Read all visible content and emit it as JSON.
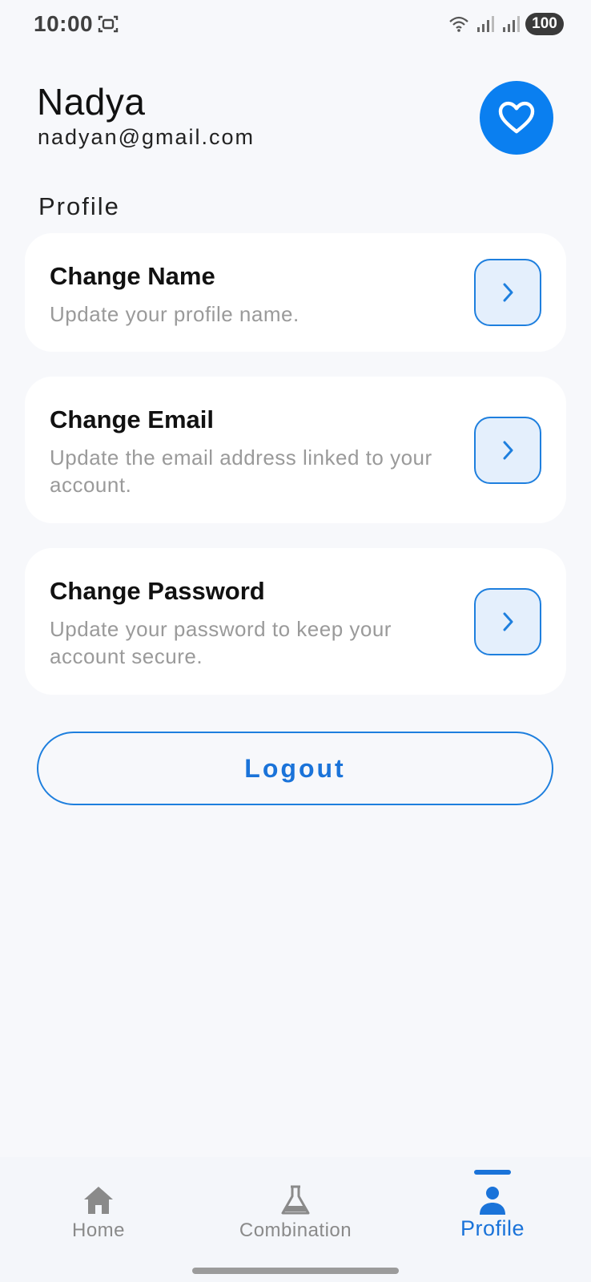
{
  "status_bar": {
    "time": "10:00",
    "battery": "100"
  },
  "user": {
    "name": "Nadya",
    "email": "nadyan@gmail.com"
  },
  "section_title": "Profile",
  "settings": [
    {
      "title": "Change Name",
      "description": "Update your profile name."
    },
    {
      "title": "Change Email",
      "description": "Update the email address linked to your account."
    },
    {
      "title": "Change Password",
      "description": "Update your password to keep your account secure."
    }
  ],
  "logout_label": "Logout",
  "nav": [
    {
      "label": "Home",
      "icon": "home-icon",
      "active": false
    },
    {
      "label": "Combination",
      "icon": "flask-icon",
      "active": false
    },
    {
      "label": "Profile",
      "icon": "person-icon",
      "active": true
    }
  ],
  "colors": {
    "accent": "#0a7ff0",
    "accent_text": "#1a73d9",
    "background": "#f7f8fb",
    "muted_text": "#9a9a9a"
  }
}
